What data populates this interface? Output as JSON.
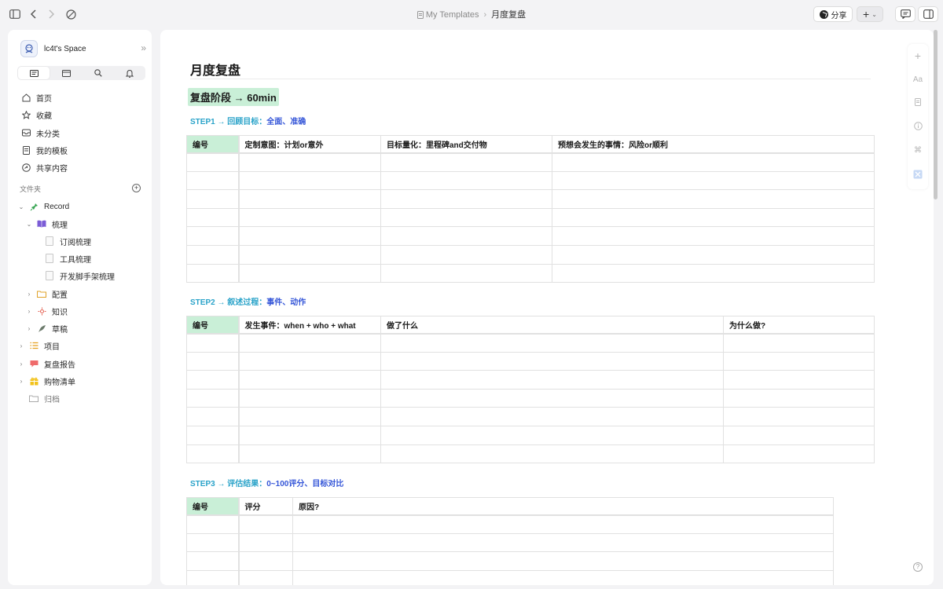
{
  "breadcrumb": {
    "parent": "My Templates",
    "current": "月度复盘"
  },
  "toolbar": {
    "share_label": "分享",
    "plus_label": "+"
  },
  "sidebar": {
    "space_name": "lc4t's Space",
    "nav": [
      "首页",
      "收藏",
      "未分类",
      "我的模板",
      "共享内容"
    ],
    "section_label": "文件夹",
    "tree": {
      "record": "Record",
      "shuli": "梳理",
      "doc1": "订阅梳理",
      "doc2": "工具梳理",
      "doc3": "开发脚手架梳理",
      "peizhi": "配置",
      "zhishi": "知识",
      "caogao": "草稿",
      "xiangmu": "项目",
      "fupan": "复盘报告",
      "gouwu": "购物清单",
      "guidang": "归档"
    }
  },
  "doc": {
    "title": "月度复盘",
    "heading": "复盘阶段 → 60min",
    "step1": {
      "a": "STEP1 → 回顾目标：",
      "b": "全面、准确"
    },
    "step2": {
      "a": "STEP2 → 叙述过程：",
      "b": "事件、动作"
    },
    "step3": {
      "a": "STEP3 → 评估结果：",
      "b": "0~100评分、目标对比"
    },
    "table1_headers": [
      "编号",
      "定制意图：计划or意外",
      "目标量化：里程碑and交付物",
      "预想会发生的事情：风险or顺利"
    ],
    "table2_headers": [
      "编号",
      "发生事件：when + who + what",
      "做了什么",
      "为什么做?"
    ],
    "table3_headers": [
      "编号",
      "评分",
      "原因?"
    ]
  },
  "rail": {
    "text_label": "Aa",
    "cmd_label": "⌘"
  },
  "help_label": "?"
}
